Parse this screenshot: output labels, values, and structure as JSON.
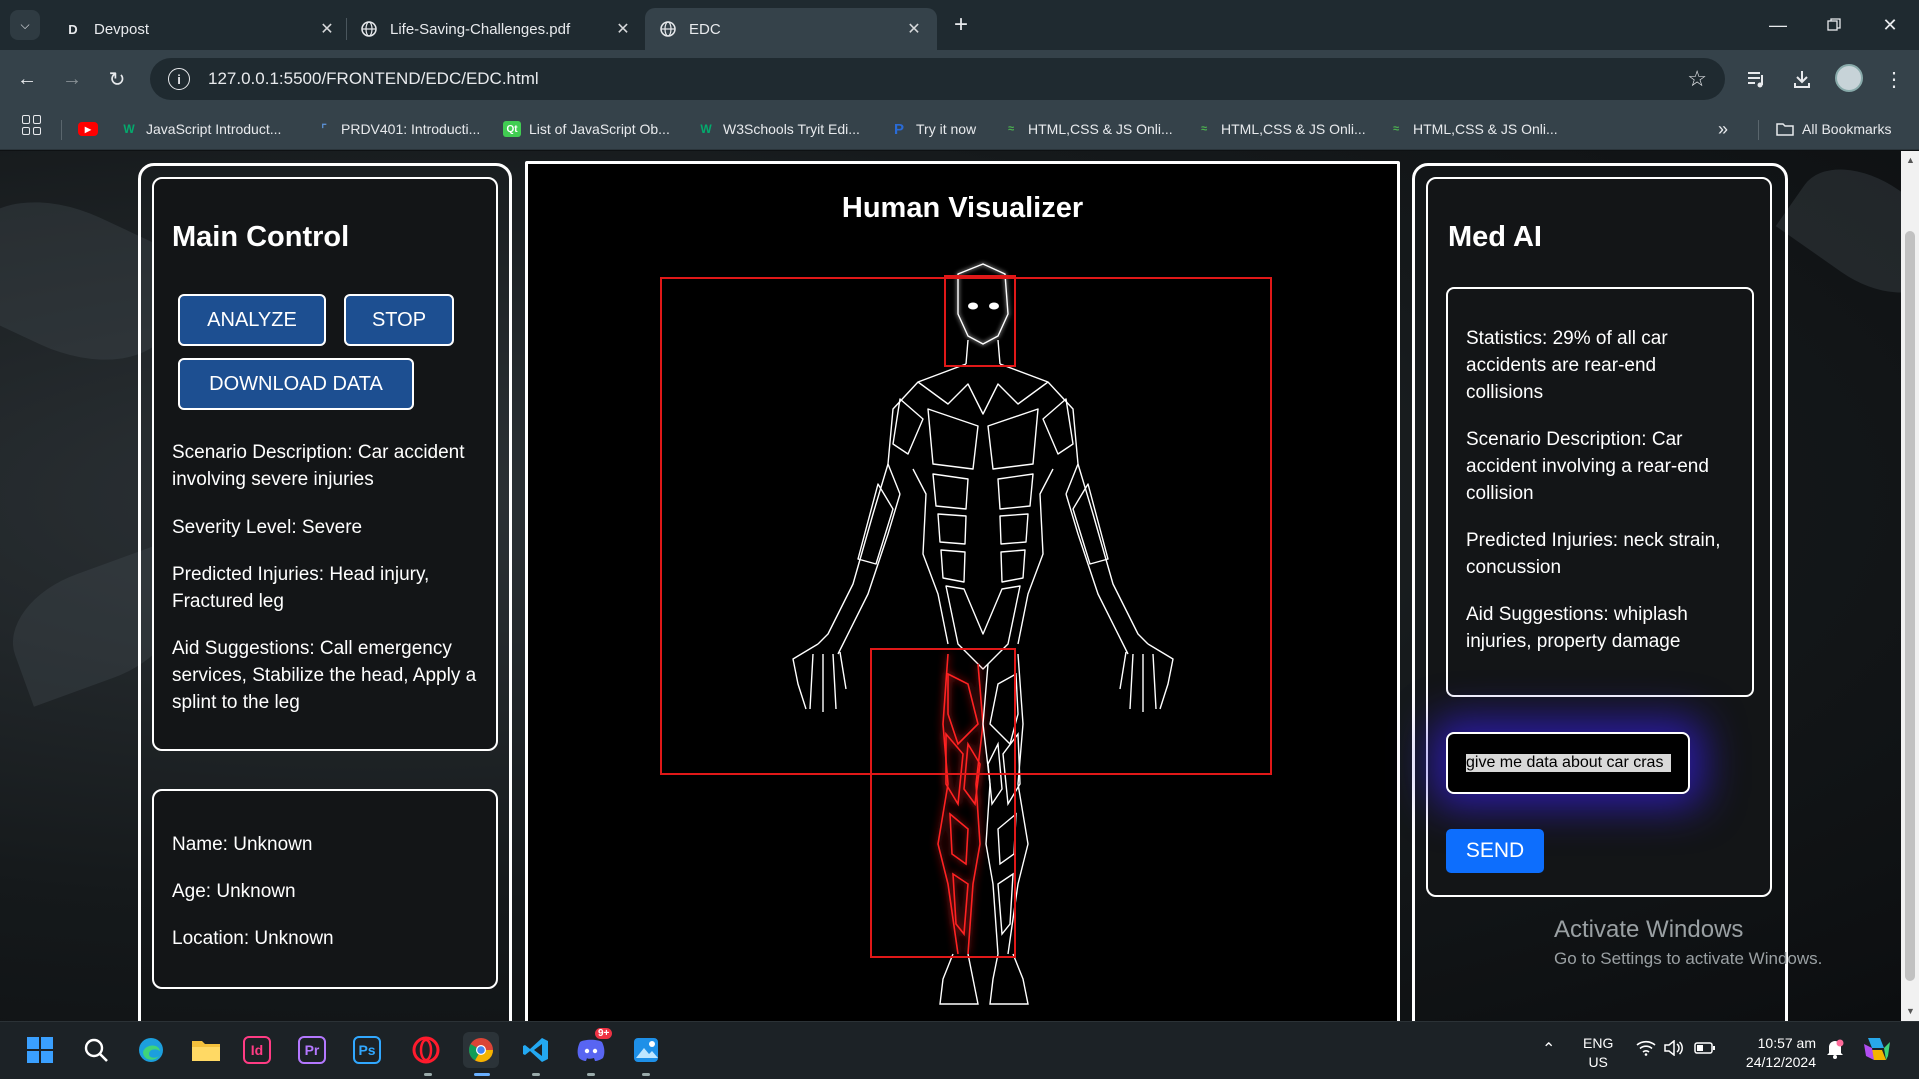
{
  "browser": {
    "tabs": [
      {
        "label": "Devpost",
        "favicon": "D"
      },
      {
        "label": "Life-Saving-Challenges.pdf",
        "favicon": "globe"
      },
      {
        "label": "EDC",
        "favicon": "globe"
      }
    ],
    "url": "127.0.0.1:5500/FRONTEND/EDC/EDC.html",
    "bookmarks": [
      {
        "label": "",
        "icon": "youtube-icon"
      },
      {
        "label": "JavaScript Introduct...",
        "icon": "w3schools-icon"
      },
      {
        "label": "PRDV401: Introducti...",
        "icon": "saylor-icon"
      },
      {
        "label": "List of JavaScript Ob...",
        "icon": "qt-icon"
      },
      {
        "label": "W3Schools Tryit Edi...",
        "icon": "w3schools-icon"
      },
      {
        "label": "Try it now",
        "icon": "p-icon"
      },
      {
        "label": "HTML,CSS & JS Onli...",
        "icon": "editor-icon"
      },
      {
        "label": "HTML,CSS & JS Onli...",
        "icon": "editor-icon"
      },
      {
        "label": "HTML,CSS & JS Onli...",
        "icon": "editor-icon"
      }
    ],
    "all_bookmarks": "All Bookmarks"
  },
  "main_control": {
    "title": "Main Control",
    "analyze": "ANALYZE",
    "stop": "STOP",
    "download": "DOWNLOAD DATA",
    "scenario": "Scenario Description: Car accident involving severe injuries",
    "severity": "Severity Level: Severe",
    "injuries": "Predicted Injuries: Head injury, Fractured leg",
    "aid": "Aid Suggestions: Call emergency services, Stabilize the head, Apply a splint to the leg"
  },
  "patient": {
    "name": "Name: Unknown",
    "age": "Age: Unknown",
    "location": "Location: Unknown"
  },
  "visualizer": {
    "title": "Human Visualizer",
    "highlight_color": "#e01818"
  },
  "med_ai": {
    "title": "Med AI",
    "messages": [
      "Statistics: 29% of all car accidents are rear-end collisions",
      "Scenario Description: Car accident involving a rear-end collision",
      "Predicted Injuries: neck strain, concussion",
      "Aid Suggestions: whiplash injuries, property damage"
    ],
    "input_value": "give me data about car cras",
    "send": "SEND"
  },
  "watermark": {
    "line1": "Activate Windows",
    "line2": "Go to Settings to activate Windows."
  },
  "taskbar": {
    "lang1": "ENG",
    "lang2": "US",
    "time": "10:57 am",
    "date": "24/12/2024",
    "discord_badge": "9+"
  }
}
